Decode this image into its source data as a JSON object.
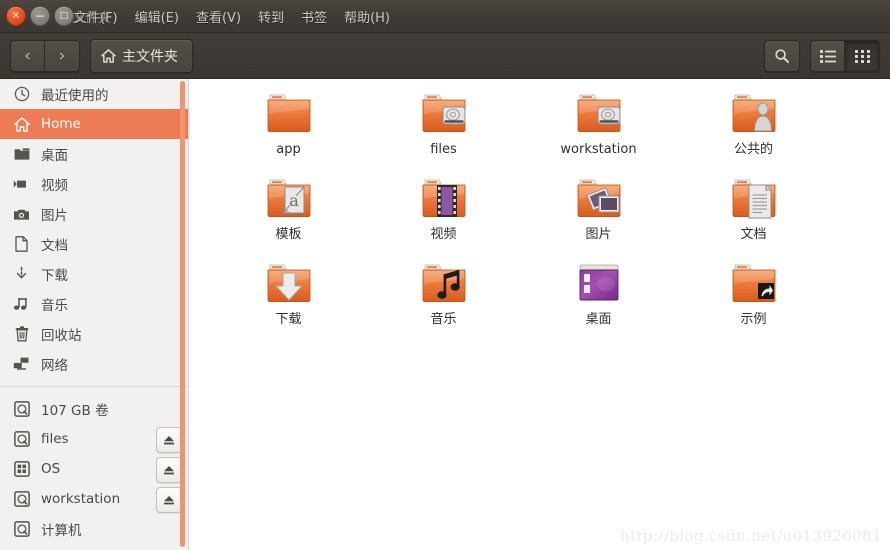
{
  "window": {
    "title": "文件夹",
    "controls": {
      "close": "×",
      "minimize": "−",
      "maximize": "□"
    }
  },
  "menubar": {
    "items": [
      {
        "label": "文件(F)",
        "name": "menu-file"
      },
      {
        "label": "编辑(E)",
        "name": "menu-edit"
      },
      {
        "label": "查看(V)",
        "name": "menu-view"
      },
      {
        "label": "转到",
        "name": "menu-go"
      },
      {
        "label": "书签",
        "name": "menu-bookmarks"
      },
      {
        "label": "帮助(H)",
        "name": "menu-help"
      }
    ]
  },
  "toolbar": {
    "back_label": "‹",
    "forward_label": "›",
    "pathbar_label": "主文件夹",
    "search_tooltip": "搜索",
    "view_list_tooltip": "列表视图",
    "view_grid_tooltip": "图标视图",
    "active_view": "grid"
  },
  "sidebar": {
    "items": [
      {
        "label": "最近使用的",
        "icon": "clock-icon",
        "selected": false,
        "eject": false
      },
      {
        "label": "Home",
        "icon": "home-icon",
        "selected": true,
        "eject": false
      },
      {
        "label": "桌面",
        "icon": "folder-icon",
        "selected": false,
        "eject": false
      },
      {
        "label": "视频",
        "icon": "video-camera-icon",
        "selected": false,
        "eject": false
      },
      {
        "label": "图片",
        "icon": "camera-icon",
        "selected": false,
        "eject": false
      },
      {
        "label": "文档",
        "icon": "document-icon",
        "selected": false,
        "eject": false
      },
      {
        "label": "下载",
        "icon": "download-icon",
        "selected": false,
        "eject": false
      },
      {
        "label": "音乐",
        "icon": "music-note-icon",
        "selected": false,
        "eject": false
      },
      {
        "label": "回收站",
        "icon": "trash-icon",
        "selected": false,
        "eject": false
      },
      {
        "label": "网络",
        "icon": "network-icon",
        "selected": false,
        "eject": false
      }
    ],
    "devices": [
      {
        "label": "107 GB 卷",
        "icon": "harddisk-icon",
        "eject": false
      },
      {
        "label": "files",
        "icon": "harddisk-icon",
        "eject": true
      },
      {
        "label": "OS",
        "icon": "windows-disk-icon",
        "eject": true
      },
      {
        "label": "workstation",
        "icon": "harddisk-icon",
        "eject": true
      },
      {
        "label": "计算机",
        "icon": "harddisk-icon",
        "eject": false
      }
    ],
    "accent_color": "#ed7b54",
    "scrollbar_color": "#f0956b"
  },
  "files": [
    {
      "label": "app",
      "icon": "folder-plain-icon"
    },
    {
      "label": "files",
      "icon": "folder-harddisk-icon"
    },
    {
      "label": "workstation",
      "icon": "folder-harddisk-icon"
    },
    {
      "label": "公共的",
      "icon": "folder-public-icon"
    },
    {
      "label": "模板",
      "icon": "folder-templates-icon"
    },
    {
      "label": "视频",
      "icon": "folder-videos-icon"
    },
    {
      "label": "图片",
      "icon": "folder-pictures-icon"
    },
    {
      "label": "文档",
      "icon": "folder-documents-icon"
    },
    {
      "label": "下载",
      "icon": "folder-downloads-icon"
    },
    {
      "label": "音乐",
      "icon": "folder-music-icon"
    },
    {
      "label": "桌面",
      "icon": "desktop-icon"
    },
    {
      "label": "示例",
      "icon": "folder-link-icon"
    }
  ],
  "watermark": {
    "text": "http://blog.csdn.net/u013926081"
  },
  "colors": {
    "folder_orange": "#e8703a",
    "titlebar": "#403b36",
    "sidebar_bg": "#f2f1f0",
    "selection": "#ed7b54"
  }
}
